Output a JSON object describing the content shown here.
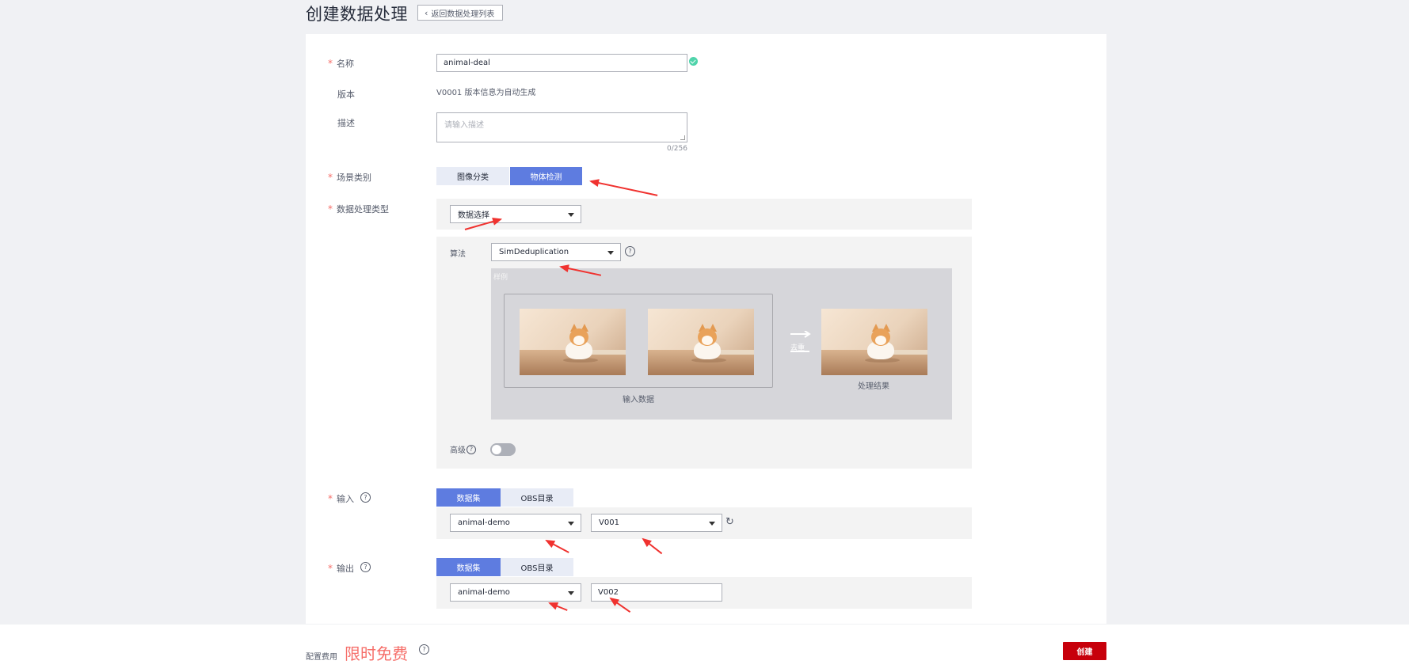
{
  "header": {
    "title": "创建数据处理",
    "back_label": "返回数据处理列表"
  },
  "form": {
    "name": {
      "label": "名称",
      "value": "animal-deal"
    },
    "version": {
      "label": "版本",
      "value": "V0001 版本信息为自动生成"
    },
    "description": {
      "label": "描述",
      "placeholder": "请输入描述",
      "counter": "0/256"
    },
    "scene": {
      "label": "场景类别",
      "options": [
        "图像分类",
        "物体检测"
      ],
      "selected": "物体检测"
    },
    "process_type": {
      "label": "数据处理类型",
      "value": "数据选择"
    },
    "algorithm": {
      "label": "算法",
      "value": "SimDeduplication"
    },
    "example": {
      "tag": "样例",
      "input_caption": "输入数据",
      "dedup_label": "去重",
      "result_caption": "处理结果"
    },
    "advanced": {
      "label": "高级",
      "enabled": false
    },
    "input": {
      "label": "输入",
      "tabs": [
        "数据集",
        "OBS目录"
      ],
      "selected_tab": "数据集",
      "dataset": "animal-demo",
      "version": "V001"
    },
    "output": {
      "label": "输出",
      "tabs": [
        "数据集",
        "OBS目录"
      ],
      "selected_tab": "数据集",
      "dataset": "animal-demo",
      "version": "V002"
    }
  },
  "footer": {
    "fee_label": "配置费用",
    "fee_value": "限时免费",
    "create_label": "创建"
  },
  "icons": {
    "required_mark": "*",
    "help": "?",
    "refresh": "↻"
  },
  "colors": {
    "primary": "#5e7ce0",
    "danger": "#c7000b",
    "highlight": "#f66f6a",
    "success": "#50d4ab"
  }
}
